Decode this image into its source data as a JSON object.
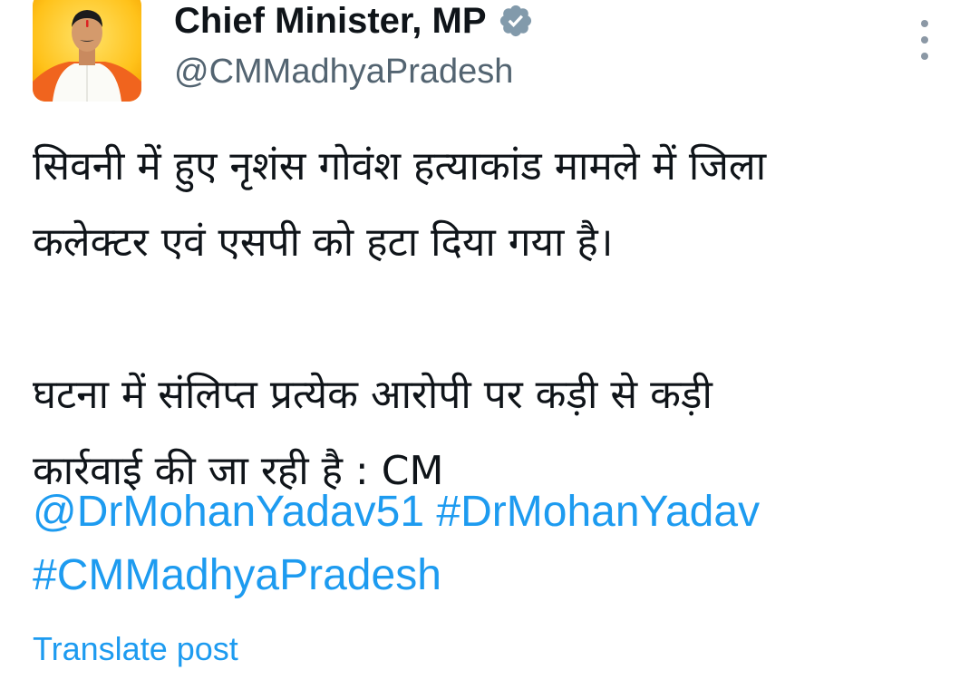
{
  "author": {
    "display_name": "Chief Minister, MP",
    "handle": "@CMMadhyaPradesh",
    "verified_badge_color": "#829aab",
    "verified_icon": "verified-badge-icon"
  },
  "post": {
    "paragraph1_line1": "सिवनी में हुए नृशंस गोवंश हत्याकांड मामले में जिला",
    "paragraph1_line2": "कलेक्टर एवं एसपी को हटा दिया गया है।",
    "paragraph2_line1": "घटना में संलिप्त प्रत्येक आरोपी पर कड़ी से कड़ी",
    "paragraph2_line2": "कार्रवाई की जा रही है : CM",
    "mention": "@DrMohanYadav51",
    "hashtag1": "#DrMohanYadav",
    "hashtag2": "#CMMadhyaPradesh",
    "link_color": "#1d9bf0"
  },
  "actions": {
    "translate_label": "Translate post",
    "more_icon": "more-options-icon"
  }
}
